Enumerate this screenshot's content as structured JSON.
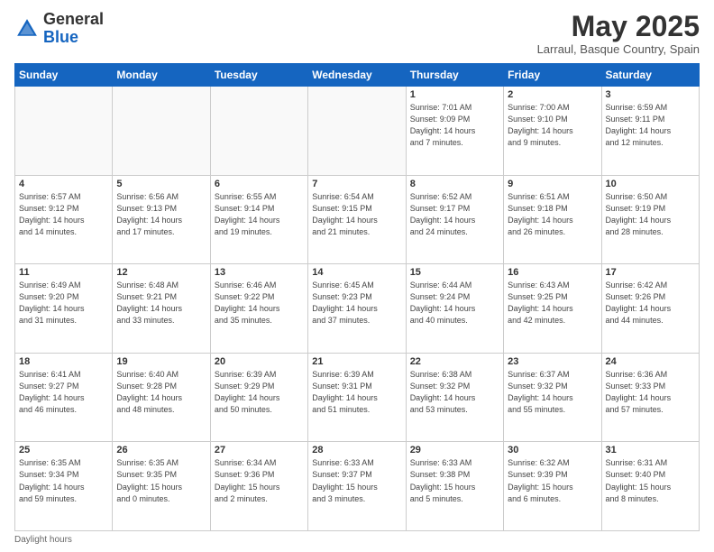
{
  "header": {
    "logo_general": "General",
    "logo_blue": "Blue",
    "month": "May 2025",
    "location": "Larraul, Basque Country, Spain"
  },
  "weekdays": [
    "Sunday",
    "Monday",
    "Tuesday",
    "Wednesday",
    "Thursday",
    "Friday",
    "Saturday"
  ],
  "weeks": [
    [
      {
        "day": "",
        "info": ""
      },
      {
        "day": "",
        "info": ""
      },
      {
        "day": "",
        "info": ""
      },
      {
        "day": "",
        "info": ""
      },
      {
        "day": "1",
        "info": "Sunrise: 7:01 AM\nSunset: 9:09 PM\nDaylight: 14 hours\nand 7 minutes."
      },
      {
        "day": "2",
        "info": "Sunrise: 7:00 AM\nSunset: 9:10 PM\nDaylight: 14 hours\nand 9 minutes."
      },
      {
        "day": "3",
        "info": "Sunrise: 6:59 AM\nSunset: 9:11 PM\nDaylight: 14 hours\nand 12 minutes."
      }
    ],
    [
      {
        "day": "4",
        "info": "Sunrise: 6:57 AM\nSunset: 9:12 PM\nDaylight: 14 hours\nand 14 minutes."
      },
      {
        "day": "5",
        "info": "Sunrise: 6:56 AM\nSunset: 9:13 PM\nDaylight: 14 hours\nand 17 minutes."
      },
      {
        "day": "6",
        "info": "Sunrise: 6:55 AM\nSunset: 9:14 PM\nDaylight: 14 hours\nand 19 minutes."
      },
      {
        "day": "7",
        "info": "Sunrise: 6:54 AM\nSunset: 9:15 PM\nDaylight: 14 hours\nand 21 minutes."
      },
      {
        "day": "8",
        "info": "Sunrise: 6:52 AM\nSunset: 9:17 PM\nDaylight: 14 hours\nand 24 minutes."
      },
      {
        "day": "9",
        "info": "Sunrise: 6:51 AM\nSunset: 9:18 PM\nDaylight: 14 hours\nand 26 minutes."
      },
      {
        "day": "10",
        "info": "Sunrise: 6:50 AM\nSunset: 9:19 PM\nDaylight: 14 hours\nand 28 minutes."
      }
    ],
    [
      {
        "day": "11",
        "info": "Sunrise: 6:49 AM\nSunset: 9:20 PM\nDaylight: 14 hours\nand 31 minutes."
      },
      {
        "day": "12",
        "info": "Sunrise: 6:48 AM\nSunset: 9:21 PM\nDaylight: 14 hours\nand 33 minutes."
      },
      {
        "day": "13",
        "info": "Sunrise: 6:46 AM\nSunset: 9:22 PM\nDaylight: 14 hours\nand 35 minutes."
      },
      {
        "day": "14",
        "info": "Sunrise: 6:45 AM\nSunset: 9:23 PM\nDaylight: 14 hours\nand 37 minutes."
      },
      {
        "day": "15",
        "info": "Sunrise: 6:44 AM\nSunset: 9:24 PM\nDaylight: 14 hours\nand 40 minutes."
      },
      {
        "day": "16",
        "info": "Sunrise: 6:43 AM\nSunset: 9:25 PM\nDaylight: 14 hours\nand 42 minutes."
      },
      {
        "day": "17",
        "info": "Sunrise: 6:42 AM\nSunset: 9:26 PM\nDaylight: 14 hours\nand 44 minutes."
      }
    ],
    [
      {
        "day": "18",
        "info": "Sunrise: 6:41 AM\nSunset: 9:27 PM\nDaylight: 14 hours\nand 46 minutes."
      },
      {
        "day": "19",
        "info": "Sunrise: 6:40 AM\nSunset: 9:28 PM\nDaylight: 14 hours\nand 48 minutes."
      },
      {
        "day": "20",
        "info": "Sunrise: 6:39 AM\nSunset: 9:29 PM\nDaylight: 14 hours\nand 50 minutes."
      },
      {
        "day": "21",
        "info": "Sunrise: 6:39 AM\nSunset: 9:31 PM\nDaylight: 14 hours\nand 51 minutes."
      },
      {
        "day": "22",
        "info": "Sunrise: 6:38 AM\nSunset: 9:32 PM\nDaylight: 14 hours\nand 53 minutes."
      },
      {
        "day": "23",
        "info": "Sunrise: 6:37 AM\nSunset: 9:32 PM\nDaylight: 14 hours\nand 55 minutes."
      },
      {
        "day": "24",
        "info": "Sunrise: 6:36 AM\nSunset: 9:33 PM\nDaylight: 14 hours\nand 57 minutes."
      }
    ],
    [
      {
        "day": "25",
        "info": "Sunrise: 6:35 AM\nSunset: 9:34 PM\nDaylight: 14 hours\nand 59 minutes."
      },
      {
        "day": "26",
        "info": "Sunrise: 6:35 AM\nSunset: 9:35 PM\nDaylight: 15 hours\nand 0 minutes."
      },
      {
        "day": "27",
        "info": "Sunrise: 6:34 AM\nSunset: 9:36 PM\nDaylight: 15 hours\nand 2 minutes."
      },
      {
        "day": "28",
        "info": "Sunrise: 6:33 AM\nSunset: 9:37 PM\nDaylight: 15 hours\nand 3 minutes."
      },
      {
        "day": "29",
        "info": "Sunrise: 6:33 AM\nSunset: 9:38 PM\nDaylight: 15 hours\nand 5 minutes."
      },
      {
        "day": "30",
        "info": "Sunrise: 6:32 AM\nSunset: 9:39 PM\nDaylight: 15 hours\nand 6 minutes."
      },
      {
        "day": "31",
        "info": "Sunrise: 6:31 AM\nSunset: 9:40 PM\nDaylight: 15 hours\nand 8 minutes."
      }
    ]
  ],
  "footer": {
    "daylight_hours": "Daylight hours"
  }
}
